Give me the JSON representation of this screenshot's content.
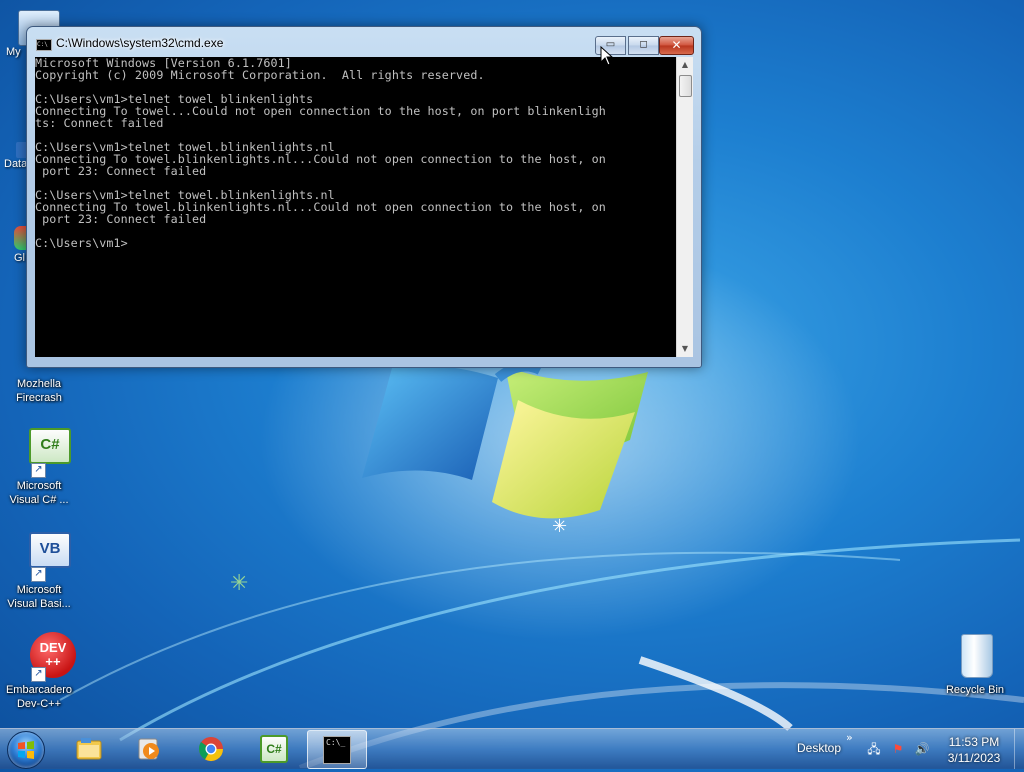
{
  "desktop": {
    "icons": [
      {
        "id": "my-computer",
        "label": "My"
      },
      {
        "id": "data",
        "label": "Data"
      },
      {
        "id": "gl",
        "label": "Gl"
      },
      {
        "id": "mozhella",
        "label": "Mozhella\nFirecrash"
      },
      {
        "id": "visual-csharp",
        "label": "Microsoft\nVisual C# ..."
      },
      {
        "id": "visual-basic",
        "label": "Microsoft\nVisual Basi..."
      },
      {
        "id": "devcpp",
        "label": "Embarcadero\nDev-C++"
      },
      {
        "id": "recycle-bin",
        "label": "Recycle Bin"
      }
    ],
    "icon_glyphs": {
      "csharp": "C#",
      "vb": "VB",
      "dev": "DEV",
      "devplus": "++"
    }
  },
  "cmd_window": {
    "title": "C:\\Windows\\system32\\cmd.exe",
    "minimize_glyph": "▭",
    "maximize_glyph": "◻",
    "close_glyph": "✕",
    "lines": [
      "Microsoft Windows [Version 6.1.7601]",
      "Copyright (c) 2009 Microsoft Corporation.  All rights reserved.",
      "",
      "C:\\Users\\vm1>telnet towel blinkenlights",
      "Connecting To towel...Could not open connection to the host, on port blinkenligh",
      "ts: Connect failed",
      "",
      "C:\\Users\\vm1>telnet towel.blinkenlights.nl",
      "Connecting To towel.blinkenlights.nl...Could not open connection to the host, on",
      " port 23: Connect failed",
      "",
      "C:\\Users\\vm1>telnet towel.blinkenlights.nl",
      "Connecting To towel.blinkenlights.nl...Could not open connection to the host, on",
      " port 23: Connect failed",
      "",
      "C:\\Users\\vm1>"
    ]
  },
  "taskbar": {
    "pinned": [
      "windows-explorer",
      "media-player",
      "chrome",
      "visual-csharp",
      "cmd"
    ],
    "cmd_glyph": "C:\\_",
    "tray": {
      "desktop_label": "Desktop",
      "chevron": "»",
      "time": "11:53 PM",
      "date": "3/11/2023"
    }
  }
}
